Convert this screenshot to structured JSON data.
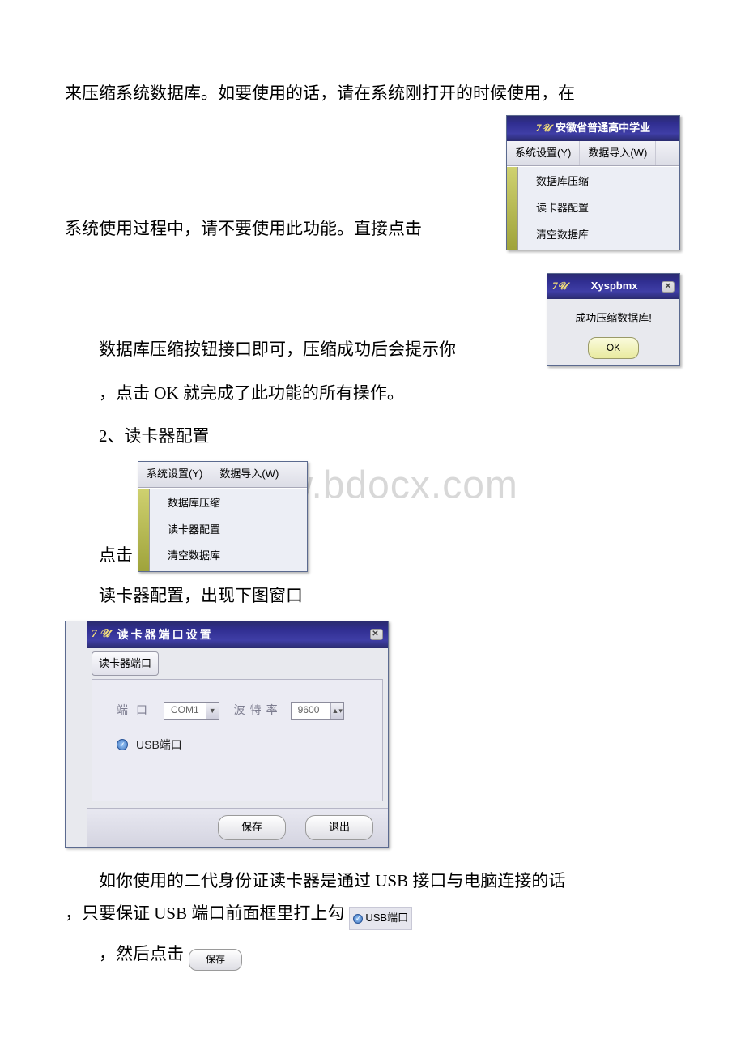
{
  "para1_a": "来压缩系统数据库。如要使用的话，请在系统刚打开的时候使用，在",
  "para1_b": "系统使用过程中，请不要使用此功能。直接点击",
  "para2": "数据库压缩按钮接口即可，压缩成功后会提示你",
  "para3": "，点击 OK 就完成了此功能的所有操作。",
  "para4": "2、读卡器配置",
  "para5_a": "点击",
  "para5_b": "读卡器配置，出现下图窗口",
  "para6a": "如你使用的二代身份证读卡器是通过 USB 接口与电脑连接的话",
  "para6b": "，只要保证 USB 端口前面框里打上勾",
  "para7": "，然后点击",
  "watermark": "www.bdocx.com",
  "topwin": {
    "title": "安徽省普通高中学业",
    "menu": {
      "m1": "系统设置(Y)",
      "m2": "数据导入(W)"
    },
    "items": {
      "i1": "数据库压缩",
      "i2": "读卡器配置",
      "i3": "清空数据库"
    }
  },
  "prompt": {
    "title": "Xyspbmx",
    "msg": "成功压缩数据库!",
    "ok": "OK"
  },
  "menu2": {
    "m1": "系统设置(Y)",
    "m2": "数据导入(W)",
    "i1": "数据库压缩",
    "i2": "读卡器配置",
    "i3": "清空数据库"
  },
  "reader": {
    "title": "读卡器端口设置",
    "tab": "读卡器端口",
    "port_label": "端口",
    "port_value": "COM1",
    "baud_label": "波特率",
    "baud_value": "9600",
    "usb_label": "USB端口",
    "save": "保存",
    "exit": "退出"
  },
  "mini": {
    "usb": "USB端口",
    "save": "保存"
  }
}
